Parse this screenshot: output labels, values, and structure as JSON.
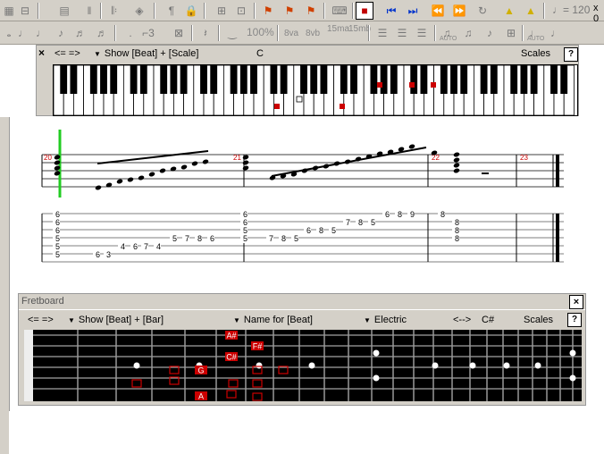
{
  "toolbar1": {
    "tempo": "♩= 120",
    "zoom": "x 0"
  },
  "toolbar2": {
    "pct": "100%",
    "labels": [
      "8va",
      "8vb",
      "15ma",
      "15mb",
      "AUTO",
      "AUTO"
    ]
  },
  "keyboard_panel": {
    "nav": "<= =>",
    "show_dropdown": "Show [Beat] + [Scale]",
    "key": "C",
    "scales": "Scales",
    "help": "?",
    "close": "×"
  },
  "score": {
    "measure_numbers": [
      "20",
      "21",
      "22",
      "23"
    ],
    "tab_numbers": [
      "6",
      "6",
      "6",
      "5",
      "5",
      "5",
      "6",
      "3",
      "4",
      "6",
      "7",
      "4",
      "5",
      "7",
      "8",
      "6",
      "6",
      "6",
      "5",
      "5",
      "7",
      "8",
      "5",
      "6",
      "8",
      "5",
      "7",
      "8",
      "5",
      "6",
      "8",
      "9",
      "8",
      "8",
      "8",
      "8"
    ]
  },
  "fretboard_panel": {
    "title": "Fretboard",
    "close": "×",
    "nav": "<= =>",
    "show_dropdown": "Show [Beat] + [Bar]",
    "name_dropdown": "Name for [Beat]",
    "instrument_dropdown": "Electric",
    "arrows": "<-->",
    "key": "C#",
    "scales": "Scales",
    "help": "?",
    "note_labels": [
      "A#",
      "F#",
      "C#",
      "G",
      "A"
    ]
  },
  "colors": {
    "toolbar_bg": "#d4d0c8",
    "fretboard_bg": "#000000",
    "note_red": "#cc0000",
    "cursor_green": "#22cc22"
  }
}
